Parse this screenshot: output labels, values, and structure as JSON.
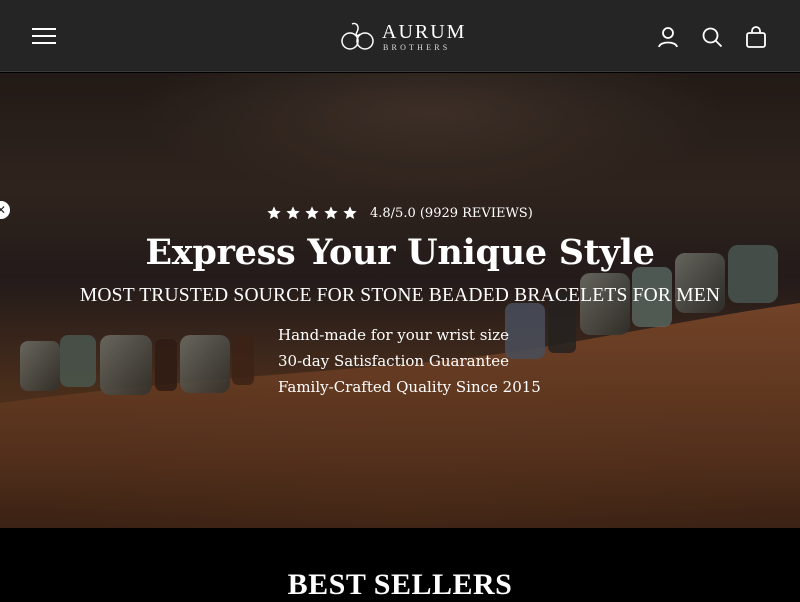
{
  "header": {
    "brand_name": "AURUM",
    "brand_sub": "BROTHERS",
    "menu_icon": "hamburger-menu-icon",
    "account_icon": "user-icon",
    "search_icon": "search-icon",
    "cart_icon": "shopping-bag-icon"
  },
  "hero": {
    "rating_text": "4.8/5.0 (9929 REVIEWS)",
    "stars": 5,
    "title": "Express Your Unique Style",
    "subtitle": "MOST TRUSTED SOURCE FOR STONE BEADED BRACELETS FOR MEN",
    "bullets": [
      "Hand-made for your wrist size",
      "30-day Satisfaction Guarantee",
      "Family-Crafted Quality Since 2015"
    ],
    "close_icon": "close-icon"
  },
  "section": {
    "title": "BEST SELLERS"
  },
  "colors": {
    "header_bg": "#252525",
    "text": "#ffffff",
    "page_bg": "#000000"
  }
}
